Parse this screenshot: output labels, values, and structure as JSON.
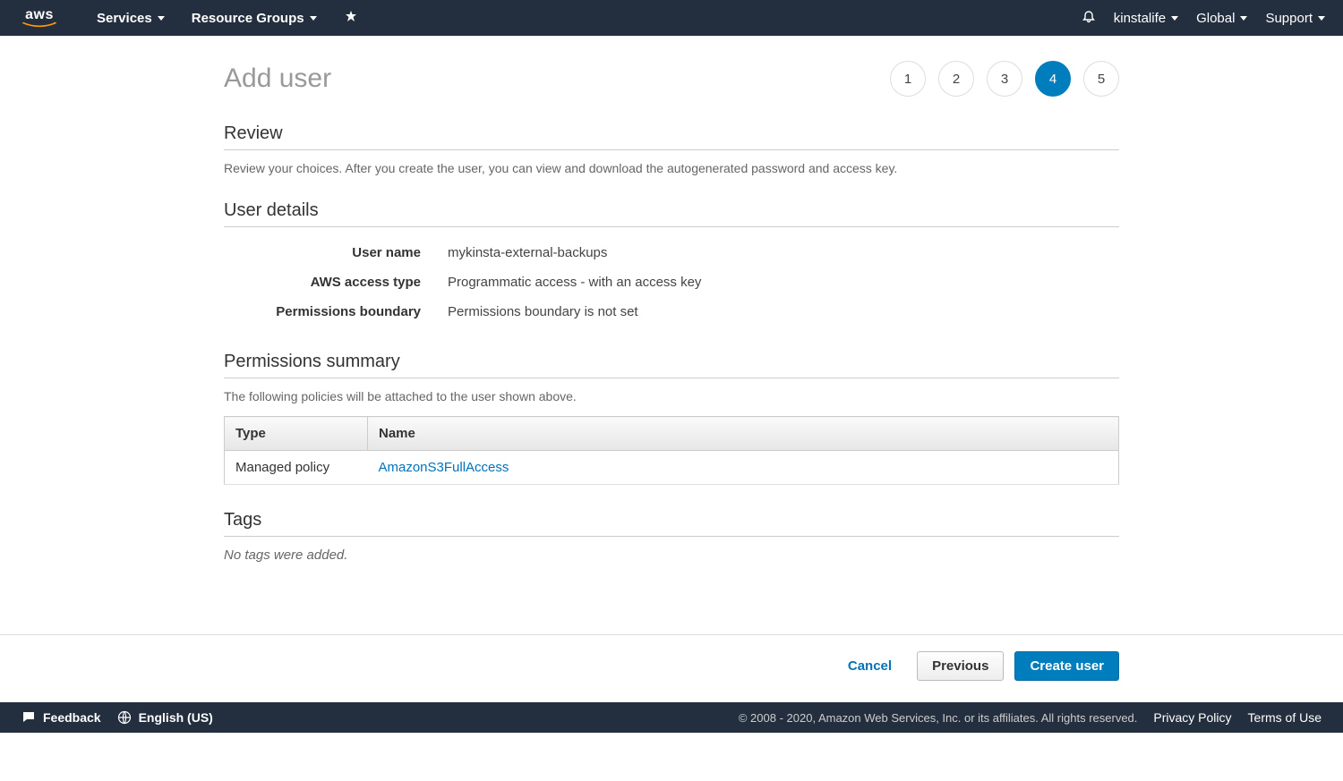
{
  "nav": {
    "logo_text": "aws",
    "services": "Services",
    "resource_groups": "Resource Groups",
    "user": "kinstalife",
    "region": "Global",
    "support": "Support"
  },
  "page": {
    "title": "Add user",
    "steps": [
      "1",
      "2",
      "3",
      "4",
      "5"
    ],
    "active_step": 4
  },
  "review": {
    "heading": "Review",
    "description": "Review your choices. After you create the user, you can view and download the autogenerated password and access key."
  },
  "user_details": {
    "heading": "User details",
    "rows": [
      {
        "label": "User name",
        "value": "mykinsta-external-backups"
      },
      {
        "label": "AWS access type",
        "value": "Programmatic access - with an access key"
      },
      {
        "label": "Permissions boundary",
        "value": "Permissions boundary is not set"
      }
    ]
  },
  "permissions": {
    "heading": "Permissions summary",
    "description": "The following policies will be attached to the user shown above.",
    "columns": {
      "type": "Type",
      "name": "Name"
    },
    "rows": [
      {
        "type": "Managed policy",
        "name": "AmazonS3FullAccess"
      }
    ]
  },
  "tags": {
    "heading": "Tags",
    "empty": "No tags were added."
  },
  "buttons": {
    "cancel": "Cancel",
    "previous": "Previous",
    "create": "Create user"
  },
  "footer": {
    "feedback": "Feedback",
    "language": "English (US)",
    "copyright": "© 2008 - 2020, Amazon Web Services, Inc. or its affiliates. All rights reserved.",
    "privacy": "Privacy Policy",
    "terms": "Terms of Use"
  }
}
